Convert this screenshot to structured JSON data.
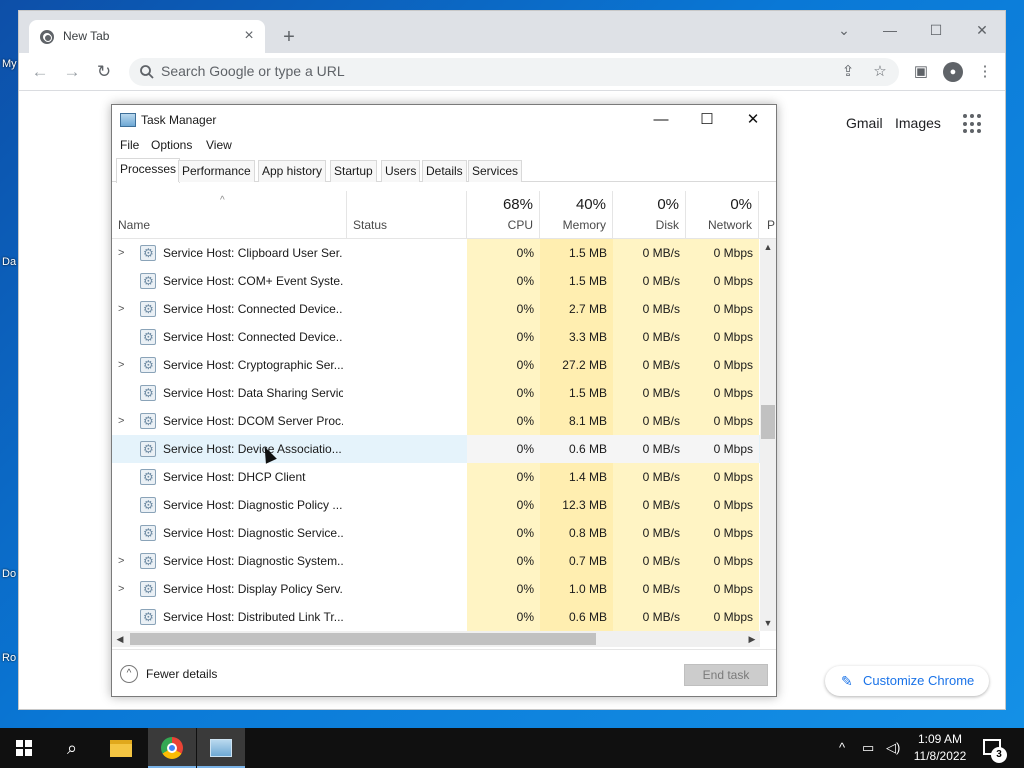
{
  "browser": {
    "tab_title": "New Tab",
    "omnibox_placeholder": "Search Google or type a URL",
    "ntp_links": {
      "gmail": "Gmail",
      "images": "Images"
    },
    "customize_label": "Customize Chrome"
  },
  "taskmgr": {
    "title": "Task Manager",
    "menus": [
      "File",
      "Options",
      "View"
    ],
    "tabs": [
      "Processes",
      "Performance",
      "App history",
      "Startup",
      "Users",
      "Details",
      "Services"
    ],
    "active_tab": "Processes",
    "columns": {
      "name": "Name",
      "status": "Status",
      "cpu": {
        "pct": "68%",
        "label": "CPU"
      },
      "memory": {
        "pct": "40%",
        "label": "Memory"
      },
      "disk": {
        "pct": "0%",
        "label": "Disk"
      },
      "network": {
        "pct": "0%",
        "label": "Network"
      },
      "power": "P"
    },
    "rows": [
      {
        "expand": true,
        "name": "Service Host: Clipboard User Ser...",
        "cpu": "0%",
        "mem": "1.5 MB",
        "disk": "0 MB/s",
        "net": "0 Mbps"
      },
      {
        "expand": false,
        "name": "Service Host: COM+ Event Syste...",
        "cpu": "0%",
        "mem": "1.5 MB",
        "disk": "0 MB/s",
        "net": "0 Mbps"
      },
      {
        "expand": true,
        "name": "Service Host: Connected Device...",
        "cpu": "0%",
        "mem": "2.7 MB",
        "disk": "0 MB/s",
        "net": "0 Mbps"
      },
      {
        "expand": false,
        "name": "Service Host: Connected Device...",
        "cpu": "0%",
        "mem": "3.3 MB",
        "disk": "0 MB/s",
        "net": "0 Mbps"
      },
      {
        "expand": true,
        "name": "Service Host: Cryptographic Ser...",
        "cpu": "0%",
        "mem": "27.2 MB",
        "disk": "0 MB/s",
        "net": "0 Mbps"
      },
      {
        "expand": false,
        "name": "Service Host: Data Sharing Service",
        "cpu": "0%",
        "mem": "1.5 MB",
        "disk": "0 MB/s",
        "net": "0 Mbps"
      },
      {
        "expand": true,
        "name": "Service Host: DCOM Server Proc...",
        "cpu": "0%",
        "mem": "8.1 MB",
        "disk": "0 MB/s",
        "net": "0 Mbps"
      },
      {
        "expand": false,
        "name": "Service Host: Device Associatio...",
        "cpu": "0%",
        "mem": "0.6 MB",
        "disk": "0 MB/s",
        "net": "0 Mbps"
      },
      {
        "expand": false,
        "name": "Service Host: DHCP Client",
        "cpu": "0%",
        "mem": "1.4 MB",
        "disk": "0 MB/s",
        "net": "0 Mbps"
      },
      {
        "expand": false,
        "name": "Service Host: Diagnostic Policy ...",
        "cpu": "0%",
        "mem": "12.3 MB",
        "disk": "0 MB/s",
        "net": "0 Mbps"
      },
      {
        "expand": false,
        "name": "Service Host: Diagnostic Service...",
        "cpu": "0%",
        "mem": "0.8 MB",
        "disk": "0 MB/s",
        "net": "0 Mbps"
      },
      {
        "expand": true,
        "name": "Service Host: Diagnostic System...",
        "cpu": "0%",
        "mem": "0.7 MB",
        "disk": "0 MB/s",
        "net": "0 Mbps"
      },
      {
        "expand": true,
        "name": "Service Host: Display Policy Serv...",
        "cpu": "0%",
        "mem": "1.0 MB",
        "disk": "0 MB/s",
        "net": "0 Mbps"
      },
      {
        "expand": false,
        "name": "Service Host: Distributed Link Tr...",
        "cpu": "0%",
        "mem": "0.6 MB",
        "disk": "0 MB/s",
        "net": "0 Mbps"
      }
    ],
    "fewer_details": "Fewer details",
    "end_task": "End task"
  },
  "taskbar": {
    "time": "1:09 AM",
    "date": "11/8/2022",
    "notification_count": "3"
  },
  "colors": {
    "metric_bg": "#fff4c4",
    "memory_bg": "#ffeeb0",
    "hover_row": "#e5f3fb",
    "accent": "#1a73e8"
  }
}
